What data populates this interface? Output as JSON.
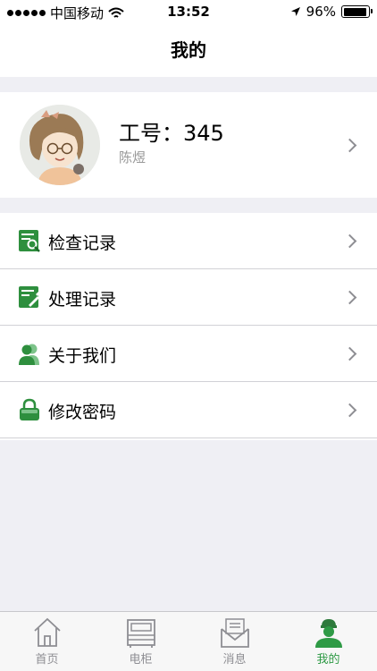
{
  "status_bar": {
    "carrier": "中国移动",
    "time": "13:52",
    "battery": "96%",
    "battery_level": 0.96
  },
  "nav": {
    "title": "我的"
  },
  "profile": {
    "employee_id": "工号：345",
    "name": "陈煜"
  },
  "menu": {
    "items": [
      {
        "label": "检查记录",
        "icon": "inspection-record-icon"
      },
      {
        "label": "处理记录",
        "icon": "process-record-icon"
      },
      {
        "label": "关于我们",
        "icon": "about-us-icon"
      },
      {
        "label": "修改密码",
        "icon": "lock-icon"
      }
    ]
  },
  "tabbar": {
    "tabs": [
      {
        "label": "首页",
        "icon": "home-icon",
        "active": false
      },
      {
        "label": "电柜",
        "icon": "cabinet-icon",
        "active": false
      },
      {
        "label": "消息",
        "icon": "message-icon",
        "active": false
      },
      {
        "label": "我的",
        "icon": "profile-icon",
        "active": true
      }
    ]
  },
  "colors": {
    "accent": "#2e9a45",
    "inactive": "#8e8e93",
    "background": "#efeff4"
  }
}
